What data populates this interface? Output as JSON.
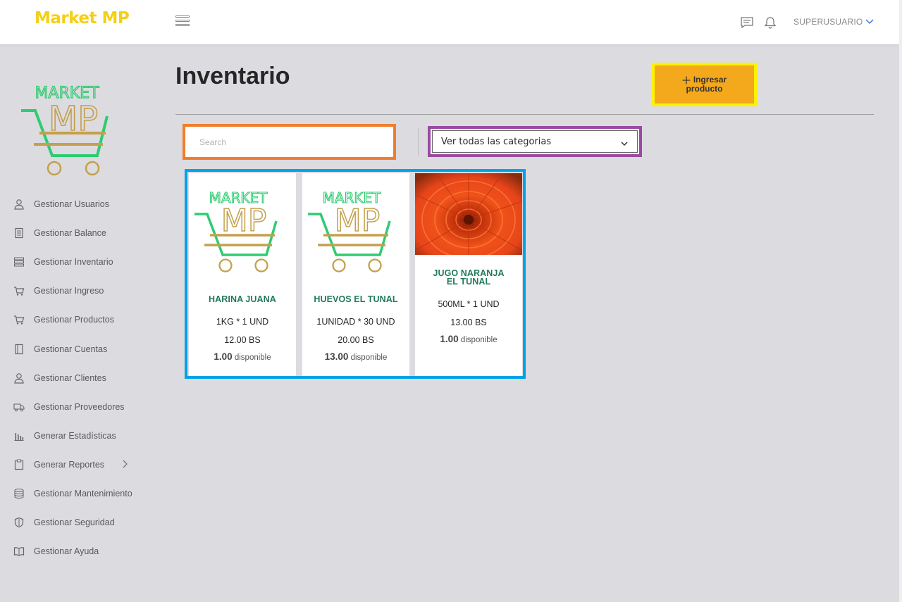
{
  "header": {
    "brand": "Market MP",
    "user": "SUPERUSUARIO",
    "icons": [
      "menu-icon",
      "chat-icon",
      "bell-icon",
      "chevron-down-icon"
    ]
  },
  "sidebar": {
    "logo_text_top": "MARKET",
    "logo_text_big": "MP",
    "items": [
      {
        "label": "Gestionar Usuarios",
        "icon": "user-icon"
      },
      {
        "label": "Gestionar Balance",
        "icon": "ledger-icon"
      },
      {
        "label": "Gestionar Inventario",
        "icon": "server-list-icon"
      },
      {
        "label": "Gestionar Ingreso",
        "icon": "cart-icon"
      },
      {
        "label": "Gestionar Productos",
        "icon": "cart-icon"
      },
      {
        "label": "Gestionar Cuentas",
        "icon": "book-icon"
      },
      {
        "label": "Gestionar Clientes",
        "icon": "user-icon"
      },
      {
        "label": "Gestionar Proveedores",
        "icon": "truck-icon"
      },
      {
        "label": "Generar Estadísticas",
        "icon": "bar-chart-icon"
      },
      {
        "label": "Generar Reportes",
        "icon": "clipboard-icon"
      },
      {
        "label": "Gestionar Mantenimiento",
        "icon": "database-icon"
      },
      {
        "label": "Gestionar Seguridad",
        "icon": "shield-icon"
      },
      {
        "label": "Gestionar Ayuda",
        "icon": "open-book-icon"
      }
    ]
  },
  "main": {
    "title": "Inventario",
    "add_button": {
      "line1": "Ingresar",
      "line2": "producto"
    },
    "search": {
      "placeholder": "Search",
      "value": ""
    },
    "category_select": {
      "selected": "Ver todas las categorias"
    },
    "products": [
      {
        "name": "HARINA JUANA",
        "presentation": "1KG * 1 UND",
        "price": "12.00 BS",
        "stock_qty": "1.00",
        "stock_label": "disponible",
        "image": "market-mp-logo"
      },
      {
        "name": "HUEVOS EL TUNAL",
        "presentation": "1UNIDAD * 30 UND",
        "price": "20.00 BS",
        "stock_qty": "13.00",
        "stock_label": "disponible",
        "image": "market-mp-logo"
      },
      {
        "name_line1": "JUGO NARANJA",
        "name_line2": "EL TUNAL",
        "presentation": "500ML * 1 UND",
        "price": "13.00 BS",
        "stock_qty": "1.00",
        "stock_label": "disponible",
        "image": "orange-flower-photo"
      }
    ]
  },
  "colors": {
    "brand_yellow": "#f5cf16",
    "button_orange": "#f4a81c",
    "product_name_green": "#1f7a5c",
    "page_bg": "#dcdbe0"
  }
}
